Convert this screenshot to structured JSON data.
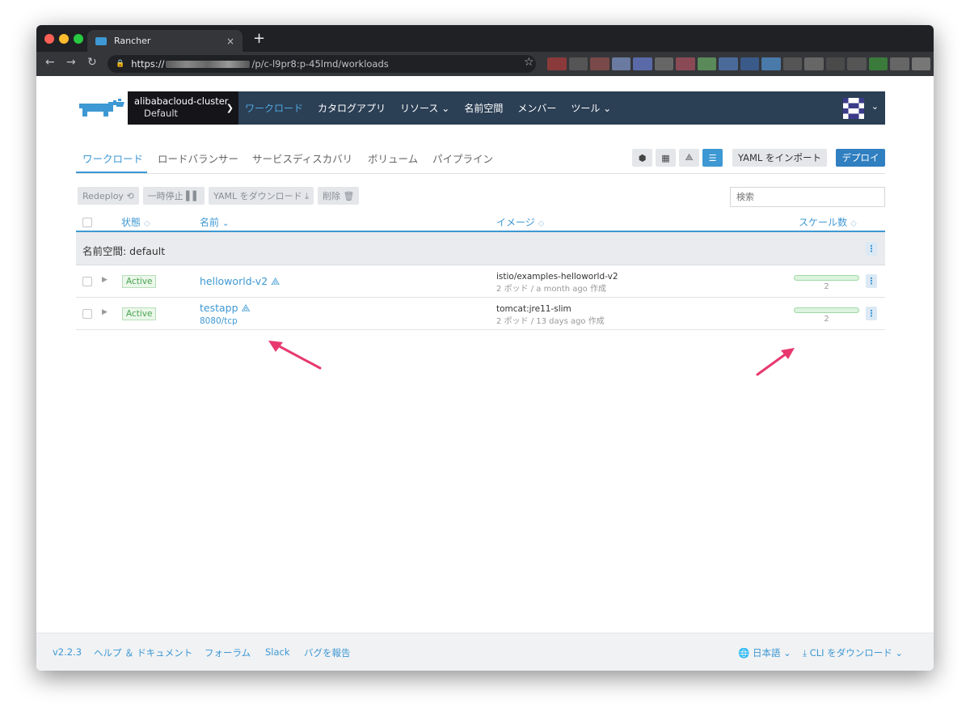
{
  "browser": {
    "tab_title": "Rancher",
    "tab_close": "×",
    "new_tab": "+",
    "url_prefix": "https://",
    "url_path": "/p/c-l9pr8:p-45lmd/workloads"
  },
  "header": {
    "cluster_name": "alibabacloud-cluster",
    "project_name": "Default",
    "menu": [
      {
        "label": "ワークロード"
      },
      {
        "label": "カタログアプリ"
      },
      {
        "label": "リソース ⌄"
      },
      {
        "label": "名前空間"
      },
      {
        "label": "メンバー"
      },
      {
        "label": "ツール ⌄"
      }
    ]
  },
  "subtabs": [
    "ワークロード",
    "ロードバランサー",
    "サービスディスカバリ",
    "ボリューム",
    "パイプライン"
  ],
  "toolbar": {
    "import_yaml": "YAML をインポート",
    "deploy": "デプロイ"
  },
  "actions": {
    "redeploy": "Redeploy ⟲",
    "pause": "一時停止 ▌▌",
    "download_yaml": "YAML をダウンロード ⤓",
    "delete": "削除 🗑"
  },
  "search": {
    "placeholder": "検索"
  },
  "table": {
    "columns": {
      "state": "状態",
      "name": "名前",
      "image": "イメージ",
      "scale": "スケール数"
    },
    "group_label": "名前空間: default",
    "rows": [
      {
        "state": "Active",
        "name": "helloworld-v2",
        "port": "",
        "image": "istio/examples-helloworld-v2",
        "meta": "2 ポッド / a month ago 作成",
        "scale": "2"
      },
      {
        "state": "Active",
        "name": "testapp",
        "port": "8080/tcp",
        "image": "tomcat:jre11-slim",
        "meta": "2 ポッド / 13 days ago 作成",
        "scale": "2"
      }
    ]
  },
  "footer": {
    "version": "v2.2.3",
    "help": "ヘルプ ＆ ドキュメント",
    "forum": "フォーラム",
    "slack": "Slack",
    "bug": "バグを報告",
    "language": "日本語 ⌄",
    "cli": "CLI をダウンロード ⌄"
  },
  "colors": {
    "accent": "#3d98d3",
    "nav": "#2b3f55",
    "active_green": "#4aa34f",
    "arrow": "#e8386e"
  }
}
